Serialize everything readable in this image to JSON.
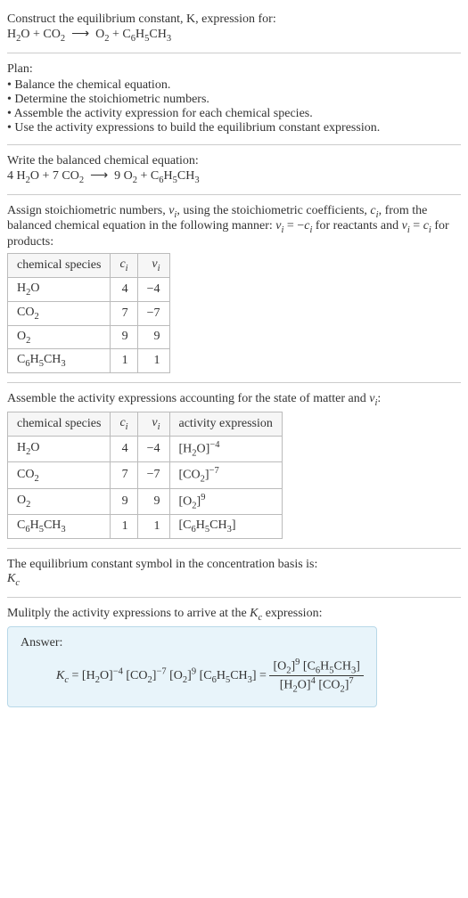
{
  "intro": {
    "line1": "Construct the equilibrium constant, K, expression for:",
    "equation": "H₂O + CO₂ ⟶ O₂ + C₆H₅CH₃"
  },
  "plan": {
    "heading": "Plan:",
    "items": [
      "Balance the chemical equation.",
      "Determine the stoichiometric numbers.",
      "Assemble the activity expression for each chemical species.",
      "Use the activity expressions to build the equilibrium constant expression."
    ]
  },
  "balanced": {
    "heading": "Write the balanced chemical equation:",
    "equation": "4 H₂O + 7 CO₂ ⟶ 9 O₂ + C₆H₅CH₃"
  },
  "stoich": {
    "text": "Assign stoichiometric numbers, νᵢ, using the stoichiometric coefficients, cᵢ, from the balanced chemical equation in the following manner: νᵢ = −cᵢ for reactants and νᵢ = cᵢ for products:",
    "headers": {
      "species": "chemical species",
      "c": "cᵢ",
      "v": "νᵢ"
    },
    "rows": [
      {
        "species": "H₂O",
        "c": "4",
        "v": "−4"
      },
      {
        "species": "CO₂",
        "c": "7",
        "v": "−7"
      },
      {
        "species": "O₂",
        "c": "9",
        "v": "9"
      },
      {
        "species": "C₆H₅CH₃",
        "c": "1",
        "v": "1"
      }
    ]
  },
  "activity": {
    "text": "Assemble the activity expressions accounting for the state of matter and νᵢ:",
    "headers": {
      "species": "chemical species",
      "c": "cᵢ",
      "v": "νᵢ",
      "act": "activity expression"
    },
    "rows": [
      {
        "species": "H₂O",
        "c": "4",
        "v": "−4",
        "act": "[H₂O]⁻⁴"
      },
      {
        "species": "CO₂",
        "c": "7",
        "v": "−7",
        "act": "[CO₂]⁻⁷"
      },
      {
        "species": "O₂",
        "c": "9",
        "v": "9",
        "act": "[O₂]⁹"
      },
      {
        "species": "C₆H₅CH₃",
        "c": "1",
        "v": "1",
        "act": "[C₆H₅CH₃]"
      }
    ]
  },
  "kc_symbol": {
    "text": "The equilibrium constant symbol in the concentration basis is:",
    "symbol": "K_c"
  },
  "multiply": {
    "text": "Mulitply the activity expressions to arrive at the K_c expression:"
  },
  "answer": {
    "label": "Answer:",
    "lhs": "K_c = [H₂O]⁻⁴ [CO₂]⁻⁷ [O₂]⁹ [C₆H₅CH₃] =",
    "frac_num": "[O₂]⁹ [C₆H₅CH₃]",
    "frac_den": "[H₂O]⁴ [CO₂]⁷"
  }
}
